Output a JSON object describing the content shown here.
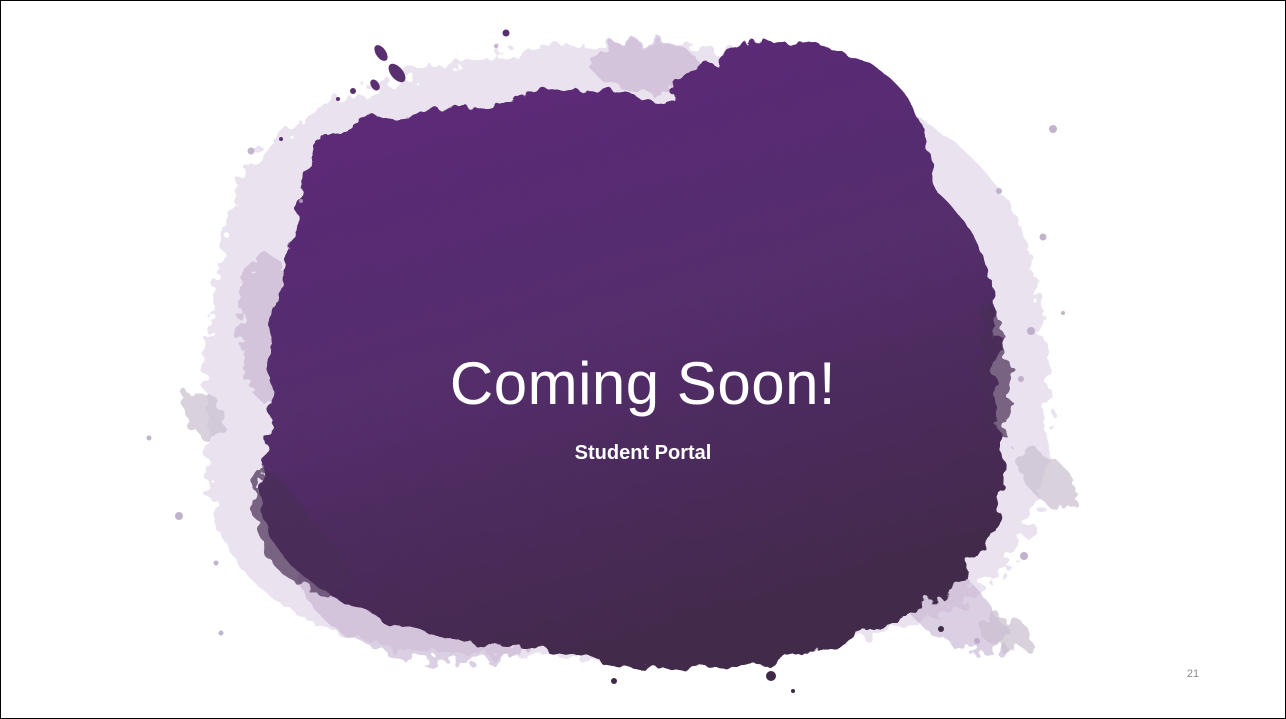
{
  "slide": {
    "title": "Coming Soon!",
    "subtitle": "Student Portal",
    "slide_number": "21"
  },
  "colors": {
    "splash_top": "#5e2d7a",
    "splash_bottom": "#452c4e",
    "splash_light": "#cbb8d8",
    "background": "#ffffff",
    "title_text": "#ffffff",
    "slide_number_text": "#8c8c8c"
  },
  "decorations": {
    "background_art": "purple-paint-splash-image"
  }
}
